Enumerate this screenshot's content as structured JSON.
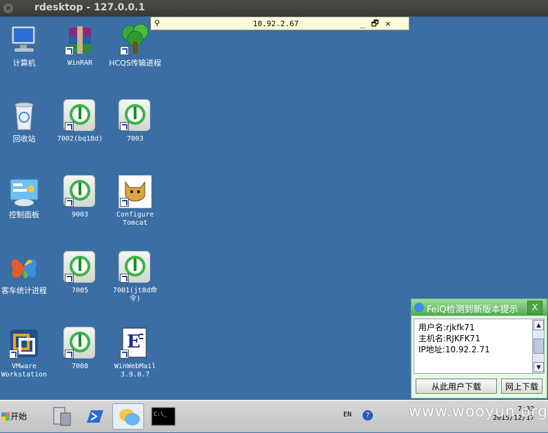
{
  "window": {
    "title": "rdesktop - 127.0.0.1",
    "close_glyph": "×"
  },
  "rdesktop_bar": {
    "ip": "10.92.2.67",
    "pin_glyph": "⚲",
    "minimize": "_",
    "restore": "🗗",
    "close": "✕"
  },
  "desktop_icons": [
    {
      "label": "计算机",
      "icon": "computer-icon"
    },
    {
      "label": "WinRAR",
      "icon": "winrar-icon"
    },
    {
      "label": "HCQS传输进程",
      "icon": "tree-icon"
    },
    {
      "label": "回收站",
      "icon": "recycle-bin-icon"
    },
    {
      "label": "7002(bq18d)",
      "icon": "green-power-icon"
    },
    {
      "label": "7003",
      "icon": "green-power-icon"
    },
    {
      "label": "控制面板",
      "icon": "control-panel-icon"
    },
    {
      "label": "9003",
      "icon": "green-power-icon"
    },
    {
      "label": "Configure\nTomcat",
      "icon": "tomcat-icon"
    },
    {
      "label": "客车统计进程",
      "icon": "butterfly-icon"
    },
    {
      "label": "7005",
      "icon": "green-power-icon"
    },
    {
      "label": "7001(jt8d命\n令)",
      "icon": "green-power-icon"
    },
    {
      "label": "VMware\nWorkstation",
      "icon": "vmware-icon"
    },
    {
      "label": "7008",
      "icon": "green-power-icon"
    },
    {
      "label": "WinWebMail\n3.9.0.7",
      "icon": "winwebmail-icon"
    }
  ],
  "popup": {
    "title": "FeiQ检测到新版本提示",
    "close_glyph": "X",
    "lines": [
      "用户名:rjkfk71",
      "主机名:RJKFK71",
      "IP地址:10.92.2.71"
    ],
    "button_user": "从此用户下载",
    "button_web": "网上下载"
  },
  "taskbar": {
    "start_label": "开始",
    "tray_lang": "EN",
    "tray_help": "?",
    "clock_time": "7:33",
    "clock_date": "2015/12/17"
  },
  "watermark": "www.wooyun.org"
}
